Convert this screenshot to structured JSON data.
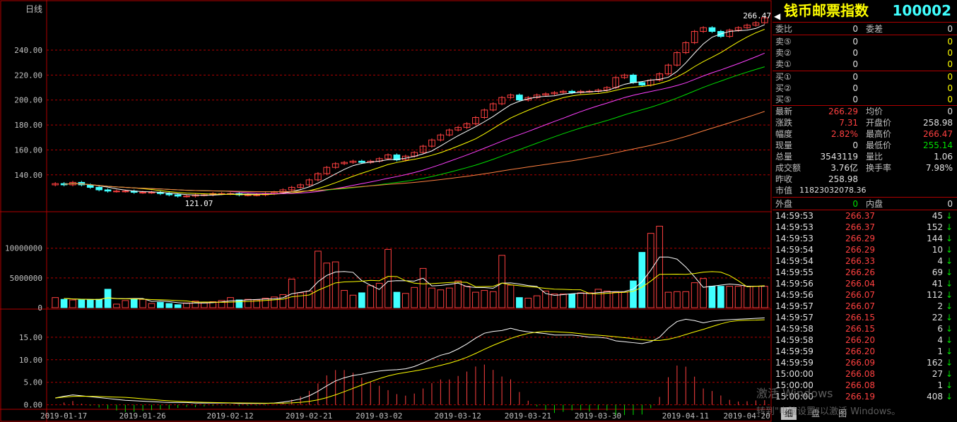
{
  "period_label": "日线",
  "main_chart": {
    "y_ticks": [
      "240.00",
      "220.00",
      "200.00",
      "180.00",
      "160.00",
      "140.00"
    ],
    "y_values": [
      240,
      220,
      200,
      180,
      160,
      140
    ],
    "high_label": "266.47",
    "low_label": "121.07"
  },
  "volume_chart": {
    "y_ticks": [
      "10000000",
      "5000000",
      "0"
    ]
  },
  "indicator_chart": {
    "y_ticks": [
      "15.00",
      "10.00",
      "5.00",
      "0.00"
    ]
  },
  "x_axis_dates": [
    "2019-01-17",
    "2019-01-26",
    "2019-02-12",
    "2019-02-21",
    "2019-03-02",
    "2019-03-12",
    "2019-03-21",
    "2019-03-30",
    "2019-04-11",
    "2019-04-20"
  ],
  "panel": {
    "name": "钱币邮票指数",
    "code": "100002",
    "order_ratio_label": "委比",
    "order_ratio": "0",
    "order_diff_label": "委差",
    "order_diff": "0",
    "asks": [
      {
        "label": "卖⑤",
        "price": "0",
        "vol": "0"
      },
      {
        "label": "卖②",
        "price": "0",
        "vol": "0"
      },
      {
        "label": "卖①",
        "price": "0",
        "vol": "0"
      }
    ],
    "bids": [
      {
        "label": "买①",
        "price": "0",
        "vol": "0"
      },
      {
        "label": "买②",
        "price": "0",
        "vol": "0"
      },
      {
        "label": "买⑤",
        "price": "0",
        "vol": "0"
      }
    ],
    "quote": [
      {
        "l1": "最新",
        "v1": "266.29",
        "c1": "red",
        "l2": "均价",
        "v2": "0",
        "c2": "wht"
      },
      {
        "l1": "涨跌",
        "v1": "7.31",
        "c1": "red",
        "l2": "开盘价",
        "v2": "258.98",
        "c2": "wht"
      },
      {
        "l1": "幅度",
        "v1": "2.82%",
        "c1": "red",
        "l2": "最高价",
        "v2": "266.47",
        "c2": "red"
      },
      {
        "l1": "现量",
        "v1": "0",
        "c1": "wht",
        "l2": "最低价",
        "v2": "255.14",
        "c2": "grn"
      },
      {
        "l1": "总量",
        "v1": "3543119",
        "c1": "wht",
        "l2": "量比",
        "v2": "1.06",
        "c2": "wht"
      },
      {
        "l1": "成交额",
        "v1": "3.76亿",
        "c1": "wht",
        "l2": "换手率",
        "v2": "7.98%",
        "c2": "wht"
      }
    ],
    "prev_close_label": "昨收",
    "prev_close": "258.98",
    "market_value_label": "市值",
    "market_value": "11823032078.36",
    "outer_label": "外盘",
    "outer": "0",
    "inner_label": "内盘",
    "inner": "0",
    "ticks": [
      {
        "time": "14:59:53",
        "price": "266.37",
        "vol": "45"
      },
      {
        "time": "14:59:53",
        "price": "266.37",
        "vol": "152"
      },
      {
        "time": "14:59:53",
        "price": "266.29",
        "vol": "144"
      },
      {
        "time": "14:59:54",
        "price": "266.29",
        "vol": "10"
      },
      {
        "time": "14:59:54",
        "price": "266.33",
        "vol": "4"
      },
      {
        "time": "14:59:55",
        "price": "266.26",
        "vol": "69"
      },
      {
        "time": "14:59:56",
        "price": "266.04",
        "vol": "41"
      },
      {
        "time": "14:59:56",
        "price": "266.07",
        "vol": "112"
      },
      {
        "time": "14:59:57",
        "price": "266.07",
        "vol": "2"
      },
      {
        "time": "14:59:57",
        "price": "266.15",
        "vol": "22"
      },
      {
        "time": "14:59:58",
        "price": "266.15",
        "vol": "6"
      },
      {
        "time": "14:59:58",
        "price": "266.20",
        "vol": "4"
      },
      {
        "time": "14:59:59",
        "price": "266.20",
        "vol": "1"
      },
      {
        "time": "14:59:59",
        "price": "266.09",
        "vol": "162"
      },
      {
        "time": "15:00:00",
        "price": "266.08",
        "vol": "27"
      },
      {
        "time": "15:00:00",
        "price": "266.08",
        "vol": "1"
      },
      {
        "time": "15:00:00",
        "price": "266.19",
        "vol": "408"
      }
    ],
    "tab_detail": "细",
    "tab_level": "盘",
    "tab_chart": "图"
  },
  "watermark_line1": "激活 Windows",
  "watermark_line2": "转到\"电脑设置\"以激活 Windows。",
  "colors": {
    "up": "#ff4040",
    "down": "#40ffff",
    "grid": "#b00000",
    "ma5": "#ffffff",
    "ma10": "#ffff00",
    "ma20": "#ff40ff",
    "ma30": "#00e000",
    "ma60": "#ff8040"
  },
  "chart_data": {
    "type": "candlestick",
    "closes": [
      133,
      132,
      134,
      132,
      130,
      128,
      127,
      127,
      127,
      126,
      126,
      126,
      125,
      124,
      123,
      123,
      124,
      124,
      125,
      125,
      125,
      124,
      124,
      124,
      125,
      126,
      128,
      130,
      132,
      136,
      141,
      146,
      149,
      150,
      151,
      150,
      151,
      153,
      156,
      152,
      155,
      158,
      163,
      168,
      172,
      176,
      178,
      181,
      186,
      192,
      197,
      202,
      204,
      200,
      202,
      204,
      205,
      206,
      207,
      206,
      207,
      207,
      208,
      210,
      218,
      220,
      214,
      212,
      216,
      221,
      228,
      238,
      246,
      255,
      258,
      255,
      251,
      256,
      258,
      260,
      262,
      266
    ],
    "volumes": [
      1700000,
      1400000,
      1300000,
      1300000,
      1300000,
      1400000,
      3100000,
      600000,
      1200000,
      1400000,
      1400000,
      700000,
      900000,
      700000,
      500000,
      800000,
      1100000,
      800000,
      1000000,
      1200000,
      1700000,
      1300000,
      1400000,
      1300000,
      1600000,
      1800000,
      2200000,
      4800000,
      2500000,
      2800000,
      9500000,
      7500000,
      7700000,
      2900000,
      2100000,
      2500000,
      3700000,
      4100000,
      9800000,
      2600000,
      2400000,
      3400000,
      6600000,
      3300000,
      3000000,
      3300000,
      4500000,
      3600000,
      2600000,
      2900000,
      2700000,
      8800000,
      3800000,
      1700000,
      1600000,
      2000000,
      2800000,
      2300000,
      2300000,
      2300000,
      2500000,
      2500000,
      3100000,
      2800000,
      2600000,
      2600000,
      4500000,
      9300000,
      12500000,
      13700000,
      2600000,
      2700000,
      2700000,
      4200000,
      4900000,
      3600000,
      3600000,
      3600000,
      3600000,
      3600000,
      3600000,
      3600000
    ],
    "indicator": [
      1.5,
      1.9,
      2.2,
      2.0,
      1.8,
      1.6,
      1.4,
      1.2,
      1.0,
      0.9,
      0.8,
      0.7,
      0.6,
      0.5,
      0.5,
      0.5,
      0.4,
      0.4,
      0.4,
      0.4,
      0.4,
      0.3,
      0.3,
      0.3,
      0.3,
      0.4,
      0.6,
      0.9,
      1.3,
      2.0,
      3.0,
      4.2,
      5.3,
      6.0,
      6.5,
      6.8,
      7.2,
      7.5,
      7.7,
      7.8,
      8.0,
      8.5,
      9.3,
      10.2,
      11.0,
      11.5,
      12.4,
      13.5,
      14.8,
      15.9,
      16.3,
      16.5,
      17.0,
      16.5,
      16.2,
      16.0,
      15.8,
      15.5,
      15.5,
      15.5,
      15.3,
      15.0,
      15.0,
      14.8,
      14.2,
      14.0,
      13.8,
      13.6,
      14.0,
      15.0,
      17.0,
      18.5,
      19.0,
      18.7,
      18.2,
      18.6,
      18.8,
      18.9,
      19.0,
      19.1,
      19.2,
      19.3
    ],
    "price_ylim": [
      115,
      270
    ],
    "volume_ylim": [
      0,
      14000000
    ],
    "indicator_ylim": [
      -1,
      20
    ]
  }
}
